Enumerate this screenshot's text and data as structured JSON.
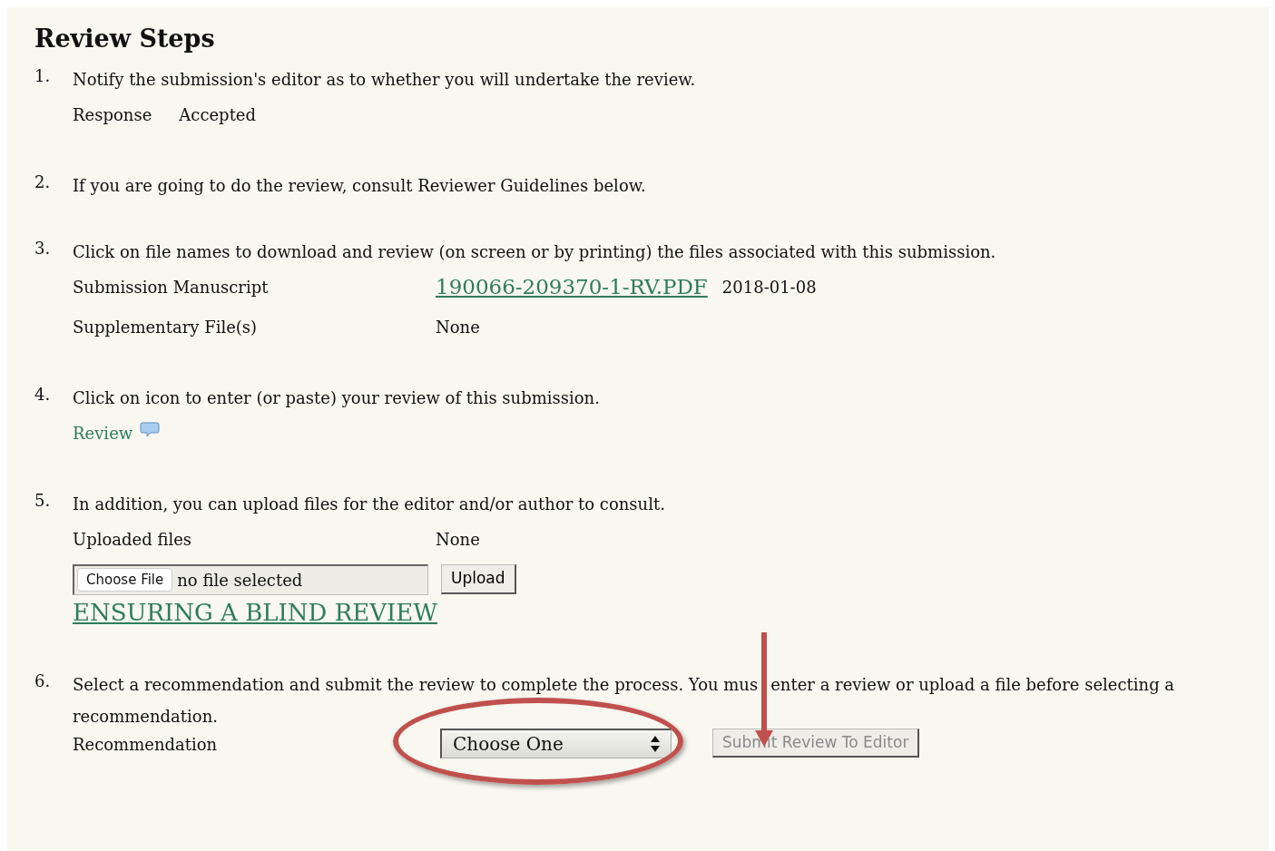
{
  "heading": "Review Steps",
  "steps": [
    {
      "number": "1.",
      "text": "Notify the submission's editor as to whether you will undertake the review.",
      "rows": [
        {
          "kind": "inline-pair",
          "label": "Response",
          "value": "Accepted"
        }
      ]
    },
    {
      "number": "2.",
      "text": "If you are going to do the review, consult Reviewer Guidelines below."
    },
    {
      "number": "3.",
      "text": "Click on file names to download and review (on screen or by printing) the files associated with this submission.",
      "rows": [
        {
          "kind": "file",
          "label": "Submission Manuscript",
          "link": "190066-209370-1-RV.PDF",
          "date": "2018-01-08"
        },
        {
          "kind": "pair",
          "label": "Supplementary File(s)",
          "value": "None"
        }
      ]
    },
    {
      "number": "4.",
      "text": "Click on icon to enter (or paste) your review of this submission.",
      "rows": [
        {
          "kind": "review-link",
          "link": "Review"
        }
      ]
    },
    {
      "number": "5.",
      "text": "In addition, you can upload files for the editor and/or author to consult.",
      "rows": [
        {
          "kind": "pair",
          "label": "Uploaded files",
          "value": "None"
        },
        {
          "kind": "upload",
          "choose_button": "Choose File",
          "file_status": "no file selected",
          "upload_button": "Upload"
        },
        {
          "kind": "blind-link",
          "link": "ENSURING A BLIND REVIEW"
        }
      ]
    },
    {
      "number": "6.",
      "text": "Select a recommendation and submit the review to complete the process. You mus",
      "text_after_arrow": "enter a review or upload a file before selecting a",
      "text_next_line": "recommendation.",
      "rows": [
        {
          "kind": "recommendation",
          "label": "Recommendation",
          "select_value": "Choose One",
          "submit_button": "Submit Review To Editor",
          "submit_disabled": true,
          "highlighted": true
        }
      ]
    }
  ]
}
